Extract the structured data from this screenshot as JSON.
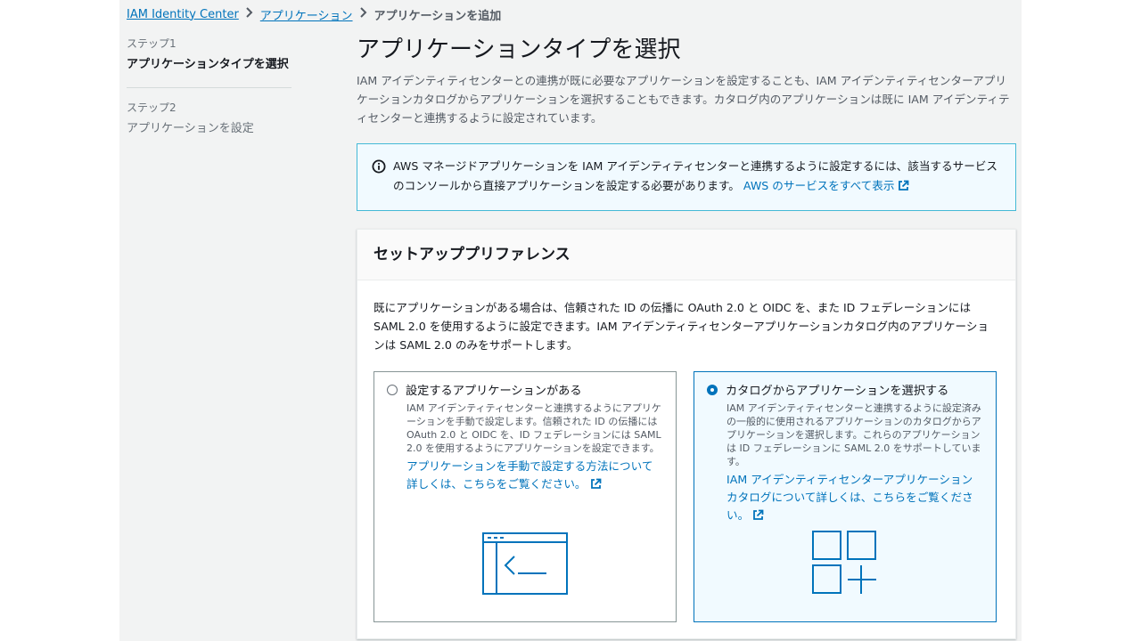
{
  "breadcrumb": {
    "items": [
      "IAM Identity Center",
      "アプリケーション"
    ],
    "current": "アプリケーションを追加"
  },
  "steps": [
    {
      "number": "ステップ1",
      "label": "アプリケーションタイプを選択"
    },
    {
      "number": "ステップ2",
      "label": "アプリケーションを設定"
    }
  ],
  "page": {
    "title": "アプリケーションタイプを選択",
    "description": "IAM アイデンティティセンターとの連携が既に必要なアプリケーションを設定することも、IAM アイデンティティセンターアプリケーションカタログからアプリケーションを選択することもできます。カタログ内のアプリケーションは既に IAM アイデンティティセンターと連携するように設定されています。"
  },
  "info": {
    "text": "AWS マネージドアプリケーションを IAM アイデンティティセンターと連携するように設定するには、該当するサービスのコンソールから直接アプリケーションを設定する必要があります。",
    "link": "AWS のサービスをすべて表示"
  },
  "panel": {
    "title": "セットアッププリファレンス",
    "description": "既にアプリケーションがある場合は、信頼された ID の伝播に OAuth 2.0 と OIDC を、また ID フェデレーションには SAML 2.0 を使用するように設定できます。IAM アイデンティティセンターアプリケーションカタログ内のアプリケーションは SAML 2.0 のみをサポートします。"
  },
  "options": [
    {
      "title": "設定するアプリケーションがある",
      "description": "IAM アイデンティティセンターと連携するようにアプリケーションを手動で設定します。信頼された ID の伝播には OAuth 2.0 と OIDC を、ID フェデレーションには SAML 2.0 を使用するようにアプリケーションを設定できます。",
      "link": "アプリケーションを手動で設定する方法について詳しくは、こちらをご覧ください。",
      "selected": false
    },
    {
      "title": "カタログからアプリケーションを選択する",
      "description": "IAM アイデンティティセンターと連携するように設定済みの一般的に使用されるアプリケーションのカタログからアプリケーションを選択します。これらのアプリケーションは ID フェデレーションに SAML 2.0 をサポートしています。",
      "link": "IAM アイデンティティセンターアプリケーションカタログについて詳しくは、こちらをご覧ください。",
      "selected": true
    }
  ],
  "colors": {
    "link": "#0073bb",
    "icon": "#0073bb",
    "info_border": "#44b9d6",
    "info_bg": "#f1faff"
  },
  "icons": {
    "breadcrumb_separator": "chevron-right-icon",
    "info": "info-circle-icon",
    "external": "external-link-icon",
    "option1": "terminal-window-icon",
    "option2": "app-grid-icon"
  }
}
